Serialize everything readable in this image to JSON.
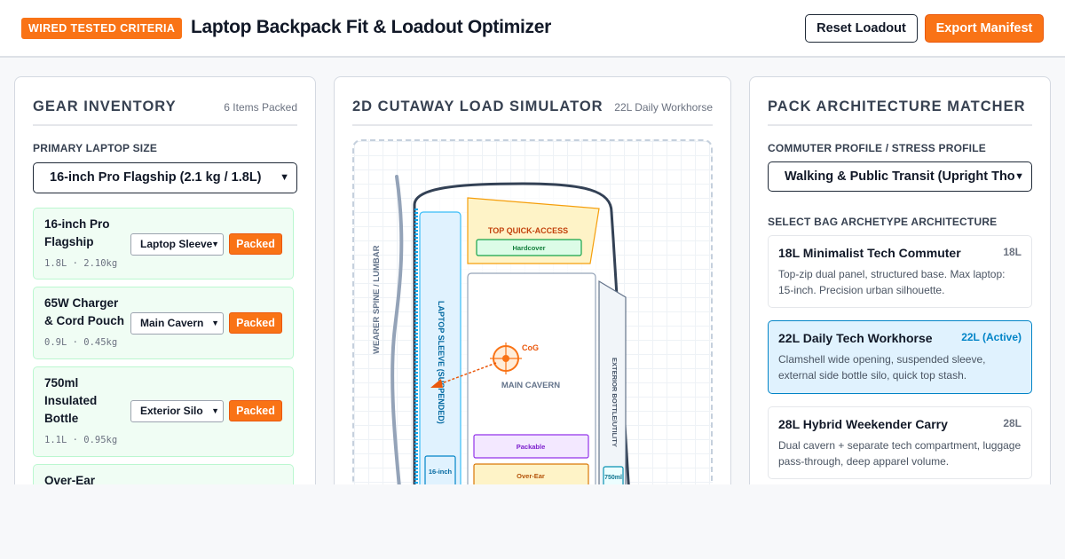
{
  "header": {
    "badge": "WIRED TESTED CRITERIA",
    "title": "Laptop Backpack Fit & Loadout Optimizer",
    "reset_label": "Reset Loadout",
    "export_label": "Export Manifest"
  },
  "inventory": {
    "title": "GEAR INVENTORY",
    "count": "6 Items Packed",
    "laptop_label": "PRIMARY LAPTOP SIZE",
    "laptop_value": "16-inch Pro Flagship (2.1 kg / 1.8L)",
    "items": [
      {
        "name": "16-inch Pro Flagship",
        "meta": "1.8L · 2.10kg",
        "slot": "Laptop Sleeve",
        "status": "Packed"
      },
      {
        "name": "65W Charger & Cord Pouch",
        "meta": "0.9L · 0.45kg",
        "slot": "Main Cavern",
        "status": "Packed"
      },
      {
        "name": "750ml Insulated Bottle",
        "meta": "1.1L · 0.95kg",
        "slot": "Exterior Silo",
        "status": "Packed"
      },
      {
        "name": "Over-Ear",
        "meta": "",
        "slot": "",
        "status": ""
      }
    ]
  },
  "simulator": {
    "title": "2D CUTAWAY LOAD SIMULATOR",
    "subtitle": "22L Daily Workhorse",
    "spine_label": "WEARER SPINE / LUMBAR",
    "sleeve_label": "LAPTOP SLEEVE (SUSPENDED)",
    "top_label": "TOP QUICK-ACCESS",
    "hardcover_label": "Hardcover",
    "cog_label": "CoG",
    "main_label": "MAIN CAVERN",
    "exterior_label": "EXTERIOR BOTTLE/UTILITY",
    "packable_label": "Packable",
    "overear_label": "Over-Ear",
    "laptop_chip": "16-inch",
    "bottle_chip": "750ml",
    "colors": {
      "accent": "#f97316",
      "sleeve": "#0284c7",
      "top_zone": "#fef3c7",
      "packable": "#f3e8ff"
    }
  },
  "architecture": {
    "title": "PACK ARCHITECTURE MATCHER",
    "profile_label": "COMMUTER PROFILE / STRESS PROFILE",
    "profile_value": "Walking & Public Transit (Upright Tho",
    "archetype_label": "SELECT BAG ARCHETYPE ARCHITECTURE",
    "cards": [
      {
        "name": "18L Minimalist Tech Commuter",
        "volume": "18L",
        "desc": "Top-zip dual panel, structured base. Max laptop: 15-inch. Precision urban silhouette.",
        "active": false
      },
      {
        "name": "22L Daily Tech Workhorse",
        "volume": "22L (Active)",
        "desc": "Clamshell wide opening, suspended sleeve, external side bottle silo, quick top stash.",
        "active": true
      },
      {
        "name": "28L Hybrid Weekender Carry",
        "volume": "28L",
        "desc": "Dual cavern + separate tech compartment, luggage pass-through, deep apparel volume.",
        "active": false
      }
    ]
  }
}
